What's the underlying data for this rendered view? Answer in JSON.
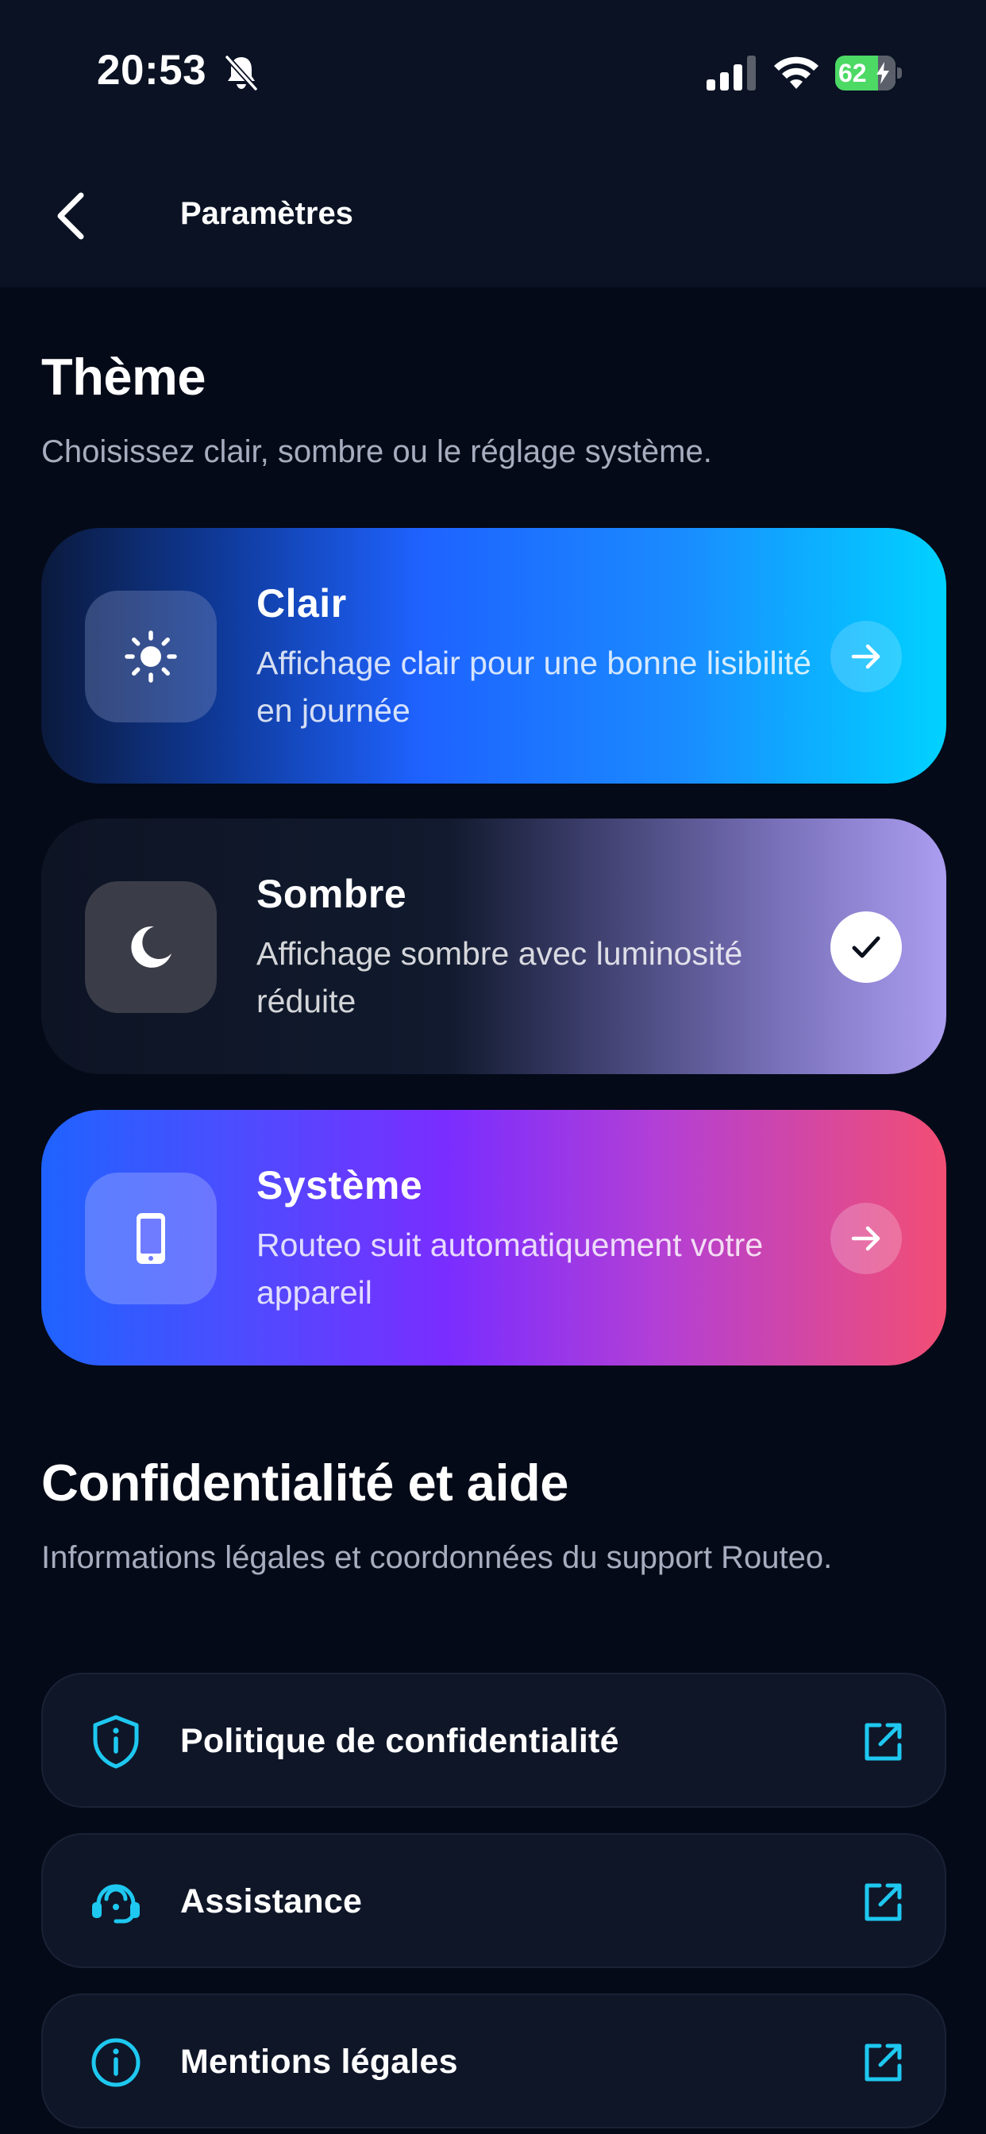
{
  "status_bar": {
    "time": "20:53",
    "battery": "62",
    "icons": [
      "bell-slash-icon",
      "cellular-signal-icon",
      "wifi-icon",
      "battery-charging-icon"
    ]
  },
  "header": {
    "title": "Paramètres",
    "back_icon": "chevron-left-icon"
  },
  "theme_section": {
    "title": "Thème",
    "subtitle": "Choisissez clair, sombre ou le réglage système.",
    "options": [
      {
        "title": "Clair",
        "description": "Affichage clair pour une bonne lisibilité en journée",
        "icon": "sun-icon",
        "action_icon": "arrow-right-icon",
        "selected": false
      },
      {
        "title": "Sombre",
        "description": "Affichage sombre avec luminosité réduite",
        "icon": "moon-icon",
        "action_icon": "checkmark-icon",
        "selected": true
      },
      {
        "title": "Système",
        "description": "Routeo suit automatiquement votre appareil",
        "icon": "smartphone-icon",
        "action_icon": "arrow-right-icon",
        "selected": false
      }
    ]
  },
  "privacy_section": {
    "title": "Confidentialité et aide",
    "subtitle": "Informations légales et coordonnées du support Routeo.",
    "links": [
      {
        "label": "Politique de confidentialité",
        "icon": "shield-info-icon",
        "action_icon": "external-link-icon"
      },
      {
        "label": "Assistance",
        "icon": "headset-support-icon",
        "action_icon": "external-link-icon"
      },
      {
        "label": "Mentions légales",
        "icon": "info-circle-icon",
        "action_icon": "external-link-icon"
      }
    ]
  },
  "colors": {
    "background": "#050a18",
    "header_background": "#0a1224",
    "accent_cyan": "#1ec8f0",
    "text_secondary": "#a7adbe",
    "battery_green": "#4cd964"
  }
}
